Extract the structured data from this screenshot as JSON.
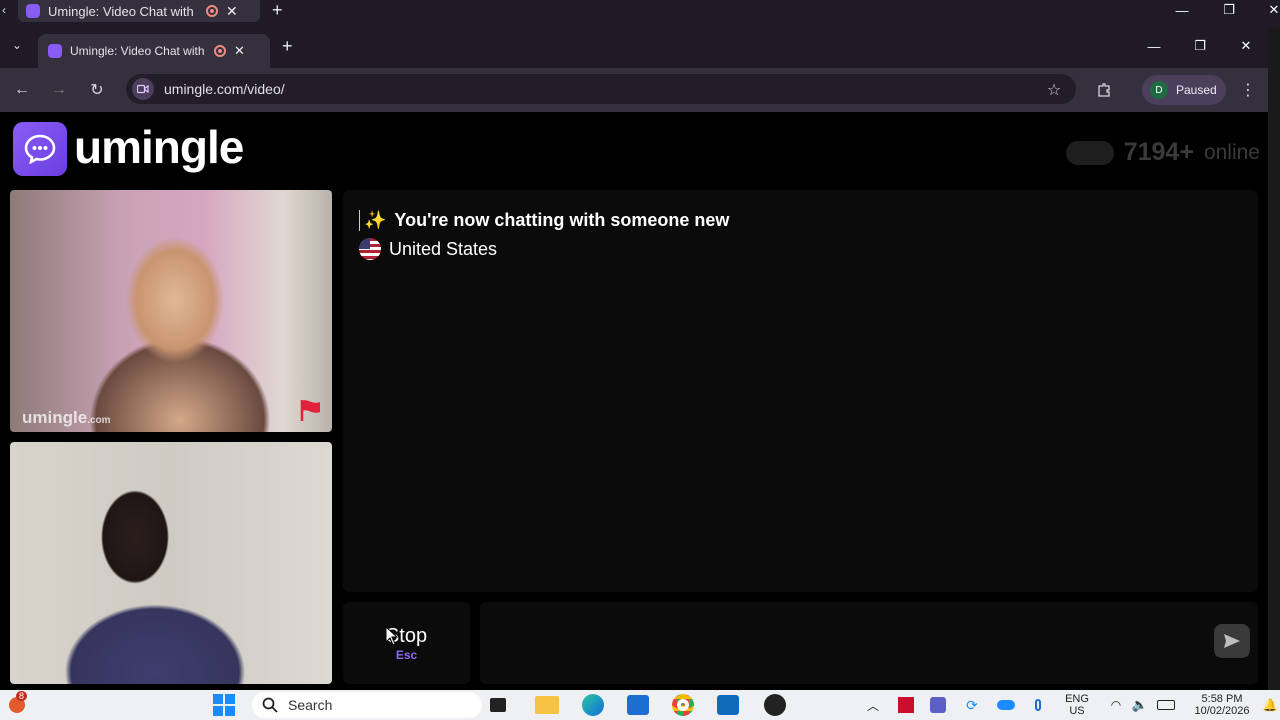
{
  "outer_window": {
    "tab_title": "Umingle: Video Chat with St"
  },
  "browser": {
    "tab_title": "Umingle: Video Chat with St",
    "url": "umingle.com/video/",
    "profile_initial": "D",
    "profile_status": "Paused"
  },
  "site": {
    "logo_text": "umingle",
    "online_count": "7194+",
    "online_label": "online"
  },
  "videos": {
    "watermark": "umingle",
    "watermark_suffix": ".com"
  },
  "chat": {
    "message": "You're now chatting with someone new",
    "country": "United States"
  },
  "controls": {
    "stop_label": "Stop",
    "stop_key": "Esc"
  },
  "taskbar": {
    "notification_count": "8",
    "search_placeholder": "Search",
    "language_line1": "ENG",
    "language_line2": "US",
    "time": "5:58 PM",
    "date": "10/02/2026"
  },
  "colors": {
    "accent": "#8b6cf0",
    "chrome_bg": "#1f1a26",
    "toolbar_bg": "#35303d"
  }
}
